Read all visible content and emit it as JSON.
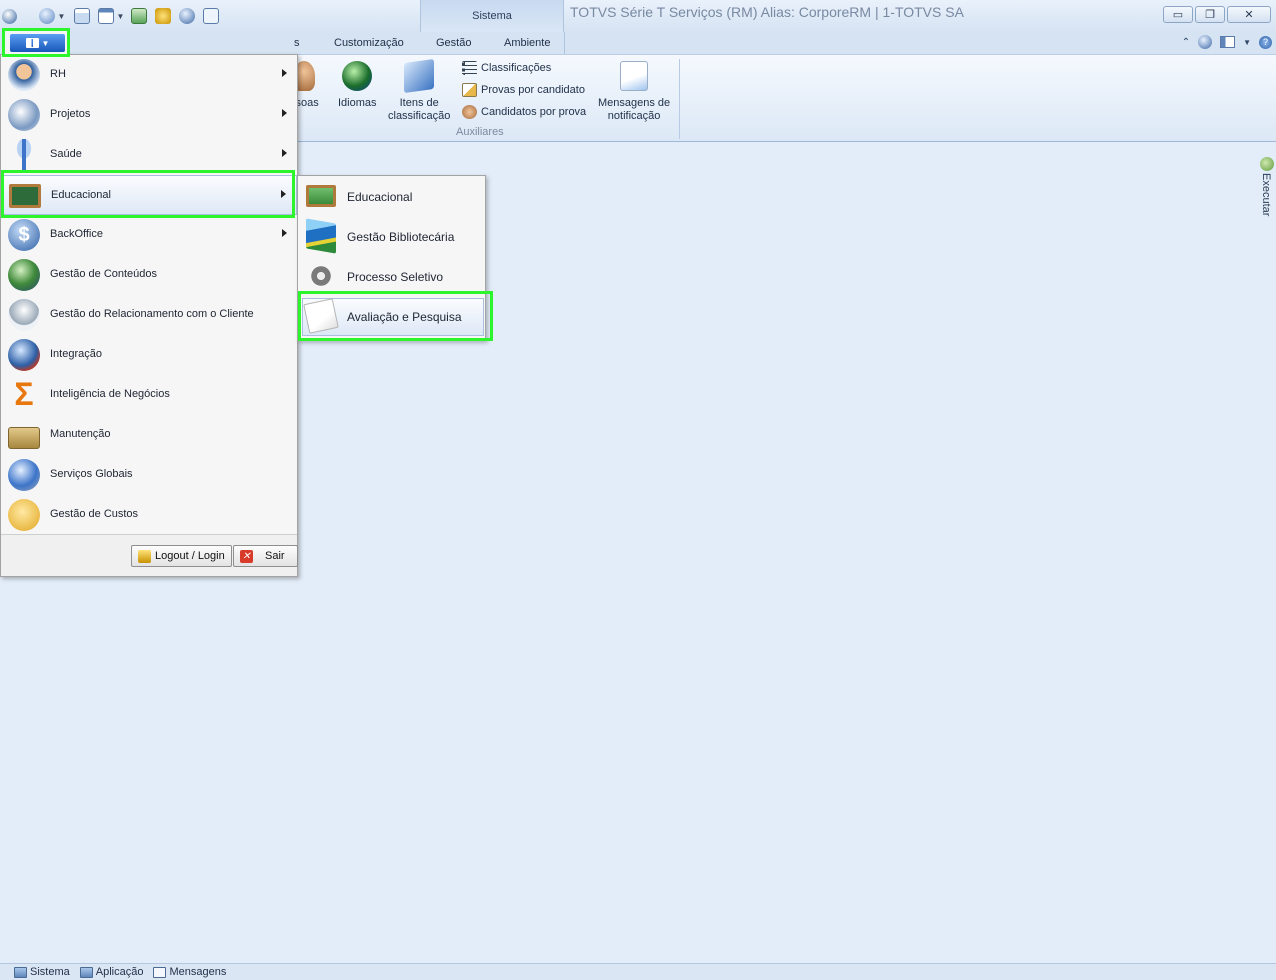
{
  "window": {
    "title": "TOTVS Série T Serviços (RM) Alias: CorporeRM | 1-TOTVS SA",
    "context_tab_header": "Sistema",
    "controls": {
      "minimize": "▭",
      "restore": "❐",
      "close": "✕"
    }
  },
  "tabs": {
    "partial_label": "s",
    "customizacao": "Customização",
    "gestao": "Gestão",
    "ambiente": "Ambiente"
  },
  "ribbon": {
    "pessoas_label": "ssoas",
    "idiomas_label": "Idiomas",
    "itens_label_1": "Itens de",
    "itens_label_2": "classificação",
    "classificacoes_label": "Classificações",
    "provas_label": "Provas por candidato",
    "candidatos_label": "Candidatos por prova",
    "mensagens_label_1": "Mensagens de",
    "mensagens_label_2": "notificação",
    "group_label": "Auxiliares"
  },
  "side_panel": {
    "executar_label": "Executar"
  },
  "main_menu": {
    "items": [
      {
        "label": "RH",
        "icon": "rh-person-icon",
        "has_submenu": true
      },
      {
        "label": "Projetos",
        "icon": "projetos-globe-icon",
        "has_submenu": true
      },
      {
        "label": "Saúde",
        "icon": "saude-caduceus-icon",
        "has_submenu": true
      },
      {
        "label": "Educacional",
        "icon": "educacional-chalkboard-icon",
        "has_submenu": true
      },
      {
        "label": "BackOffice",
        "icon": "backoffice-dollar-icon",
        "has_submenu": true
      },
      {
        "label": "Gestão de Conteúdos",
        "icon": "conteudos-globe-icon",
        "has_submenu": false
      },
      {
        "label": "Gestão do Relacionamento com o Cliente",
        "icon": "crm-antenna-icon",
        "has_submenu": false
      },
      {
        "label": "Integração",
        "icon": "integracao-globe-icon",
        "has_submenu": false
      },
      {
        "label": "Inteligência de Negócios",
        "icon": "sigma-icon",
        "has_submenu": false
      },
      {
        "label": "Manutenção",
        "icon": "toolbox-icon",
        "has_submenu": false
      },
      {
        "label": "Serviços Globais",
        "icon": "globe-gear-icon",
        "has_submenu": false
      },
      {
        "label": "Gestão de Custos",
        "icon": "piggy-bank-icon",
        "has_submenu": false
      }
    ],
    "footer": {
      "logout_label": "Logout / Login",
      "exit_label": "Sair"
    }
  },
  "submenu": {
    "items": [
      {
        "label": "Educacional",
        "icon": "chalkboard-icon"
      },
      {
        "label": "Gestão Bibliotecária",
        "icon": "books-icon"
      },
      {
        "label": "Processo Seletivo",
        "icon": "gears-icon"
      },
      {
        "label": "Avaliação e Pesquisa",
        "icon": "clipboard-check-icon"
      }
    ]
  },
  "statusbar": {
    "sistema": "Sistema",
    "aplicacao": "Aplicação",
    "mensagens": "Mensagens"
  },
  "colors": {
    "highlight": "#2cf52c",
    "workspace": "#e3edf9",
    "app_button": "#1957b8"
  }
}
